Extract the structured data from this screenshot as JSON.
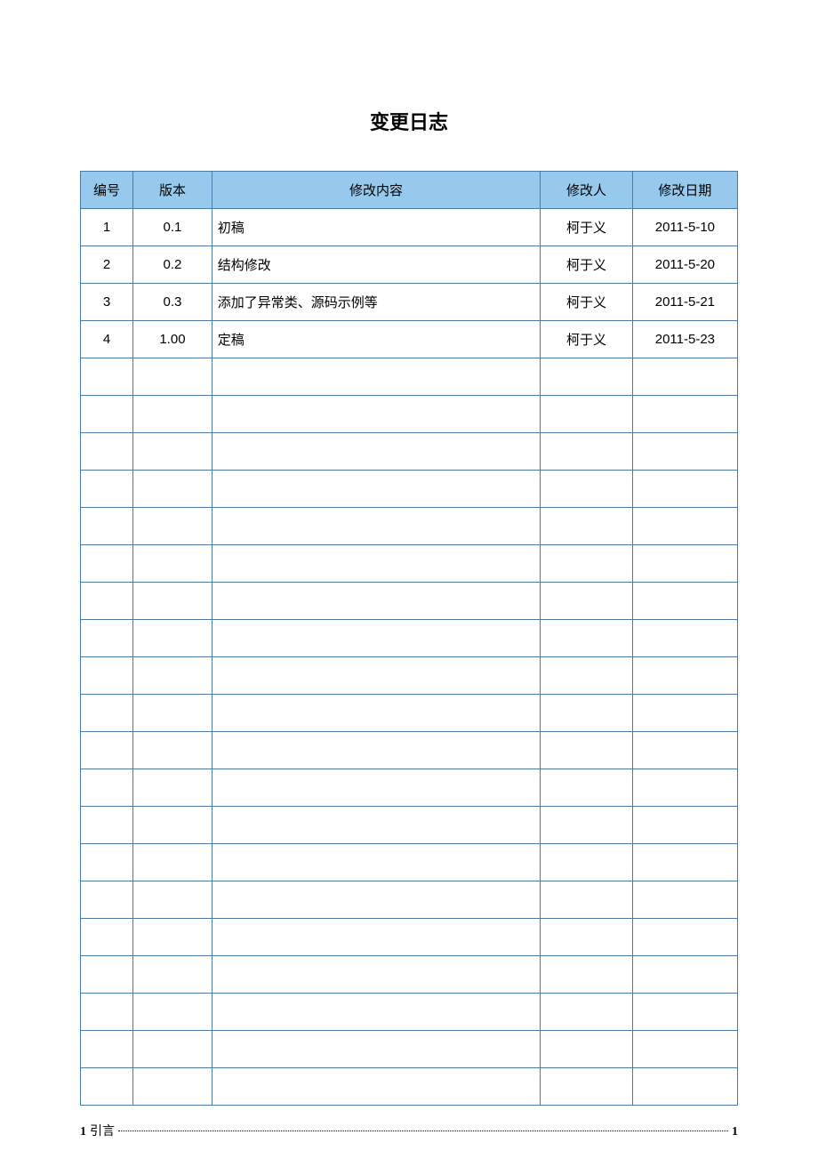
{
  "title": "变更日志",
  "headers": {
    "id": "编号",
    "version": "版本",
    "content": "修改内容",
    "author": "修改人",
    "date": "修改日期"
  },
  "rows": [
    {
      "id": "1",
      "version": "0.1",
      "content": "初稿",
      "author": "柯于义",
      "date": "2011-5-10"
    },
    {
      "id": "2",
      "version": "0.2",
      "content": "结构修改",
      "author": "柯于义",
      "date": "2011-5-20"
    },
    {
      "id": "3",
      "version": "0.3",
      "content": "添加了异常类、源码示例等",
      "author": "柯于义",
      "date": "2011-5-21"
    },
    {
      "id": "4",
      "version": "1.00",
      "content": "定稿",
      "author": "柯于义",
      "date": "2011-5-23"
    },
    {
      "id": "",
      "version": "",
      "content": "",
      "author": "",
      "date": ""
    },
    {
      "id": "",
      "version": "",
      "content": "",
      "author": "",
      "date": ""
    },
    {
      "id": "",
      "version": "",
      "content": "",
      "author": "",
      "date": ""
    },
    {
      "id": "",
      "version": "",
      "content": "",
      "author": "",
      "date": ""
    },
    {
      "id": "",
      "version": "",
      "content": "",
      "author": "",
      "date": ""
    },
    {
      "id": "",
      "version": "",
      "content": "",
      "author": "",
      "date": ""
    },
    {
      "id": "",
      "version": "",
      "content": "",
      "author": "",
      "date": ""
    },
    {
      "id": "",
      "version": "",
      "content": "",
      "author": "",
      "date": ""
    },
    {
      "id": "",
      "version": "",
      "content": "",
      "author": "",
      "date": ""
    },
    {
      "id": "",
      "version": "",
      "content": "",
      "author": "",
      "date": ""
    },
    {
      "id": "",
      "version": "",
      "content": "",
      "author": "",
      "date": ""
    },
    {
      "id": "",
      "version": "",
      "content": "",
      "author": "",
      "date": ""
    },
    {
      "id": "",
      "version": "",
      "content": "",
      "author": "",
      "date": ""
    },
    {
      "id": "",
      "version": "",
      "content": "",
      "author": "",
      "date": ""
    },
    {
      "id": "",
      "version": "",
      "content": "",
      "author": "",
      "date": ""
    },
    {
      "id": "",
      "version": "",
      "content": "",
      "author": "",
      "date": ""
    },
    {
      "id": "",
      "version": "",
      "content": "",
      "author": "",
      "date": ""
    },
    {
      "id": "",
      "version": "",
      "content": "",
      "author": "",
      "date": ""
    },
    {
      "id": "",
      "version": "",
      "content": "",
      "author": "",
      "date": ""
    },
    {
      "id": "",
      "version": "",
      "content": "",
      "author": "",
      "date": ""
    }
  ],
  "toc": {
    "number": "1",
    "label": "引言",
    "page": "1"
  }
}
